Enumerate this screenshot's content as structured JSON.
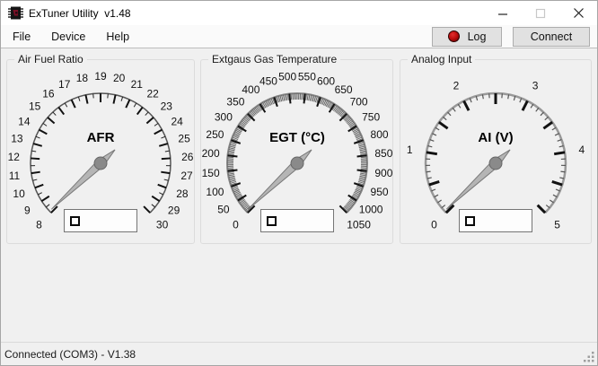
{
  "window": {
    "title": "ExTuner Utility  v1.48"
  },
  "icons": {
    "app": "chip-icon",
    "minimize": "minimize-line",
    "maximize": "maximize-square",
    "close": "close-x",
    "log_led": "red-record-led",
    "resize": "resize-grip-dots",
    "value_indicator": "indicator-square"
  },
  "menu": {
    "items": [
      {
        "label": "File"
      },
      {
        "label": "Device"
      },
      {
        "label": "Help"
      }
    ]
  },
  "toolbar": {
    "log_label": "Log",
    "connect_label": "Connect",
    "led_color": "#b41212"
  },
  "status": {
    "text": "Connected (COM3) - V1.38"
  },
  "colors": {
    "window_bg": "#f0f0f0",
    "titlebar_bg": "#ffffff",
    "button_bg": "#e1e1e1",
    "button_border": "#adadad",
    "needle": "#b5b5b5",
    "hub": "#8a8a8a"
  },
  "gauges": [
    {
      "group_title": "Air Fuel Ratio",
      "center_label": "AFR",
      "min": 8,
      "max": 30,
      "label_step": 1,
      "major_step": 1,
      "minor_step": 0.5,
      "value": 8.15,
      "scale_labels": [
        "8",
        "9",
        "10",
        "11",
        "12",
        "13",
        "14",
        "15",
        "16",
        "17",
        "18",
        "19",
        "20",
        "21",
        "22",
        "23",
        "24",
        "25",
        "26",
        "27",
        "28",
        "29",
        "30"
      ]
    },
    {
      "group_title": "Extgaus Gas Temperature",
      "center_label": "EGT (°C)",
      "min": 0,
      "max": 1050,
      "label_step": 50,
      "major_step": 50,
      "minor_step": 5,
      "value": 7,
      "scale_labels": [
        "0",
        "50",
        "100",
        "150",
        "200",
        "250",
        "300",
        "350",
        "400",
        "450",
        "500",
        "550",
        "600",
        "650",
        "700",
        "750",
        "800",
        "850",
        "900",
        "950",
        "1000",
        "1050"
      ]
    },
    {
      "group_title": "Analog Input",
      "center_label": "AI (V)",
      "min": 0,
      "max": 5,
      "label_step": 1,
      "major_step": 0.5,
      "minor_step": 0.1,
      "value": 0.035,
      "scale_labels": [
        "0",
        "1",
        "2",
        "3",
        "4",
        "5"
      ]
    }
  ]
}
